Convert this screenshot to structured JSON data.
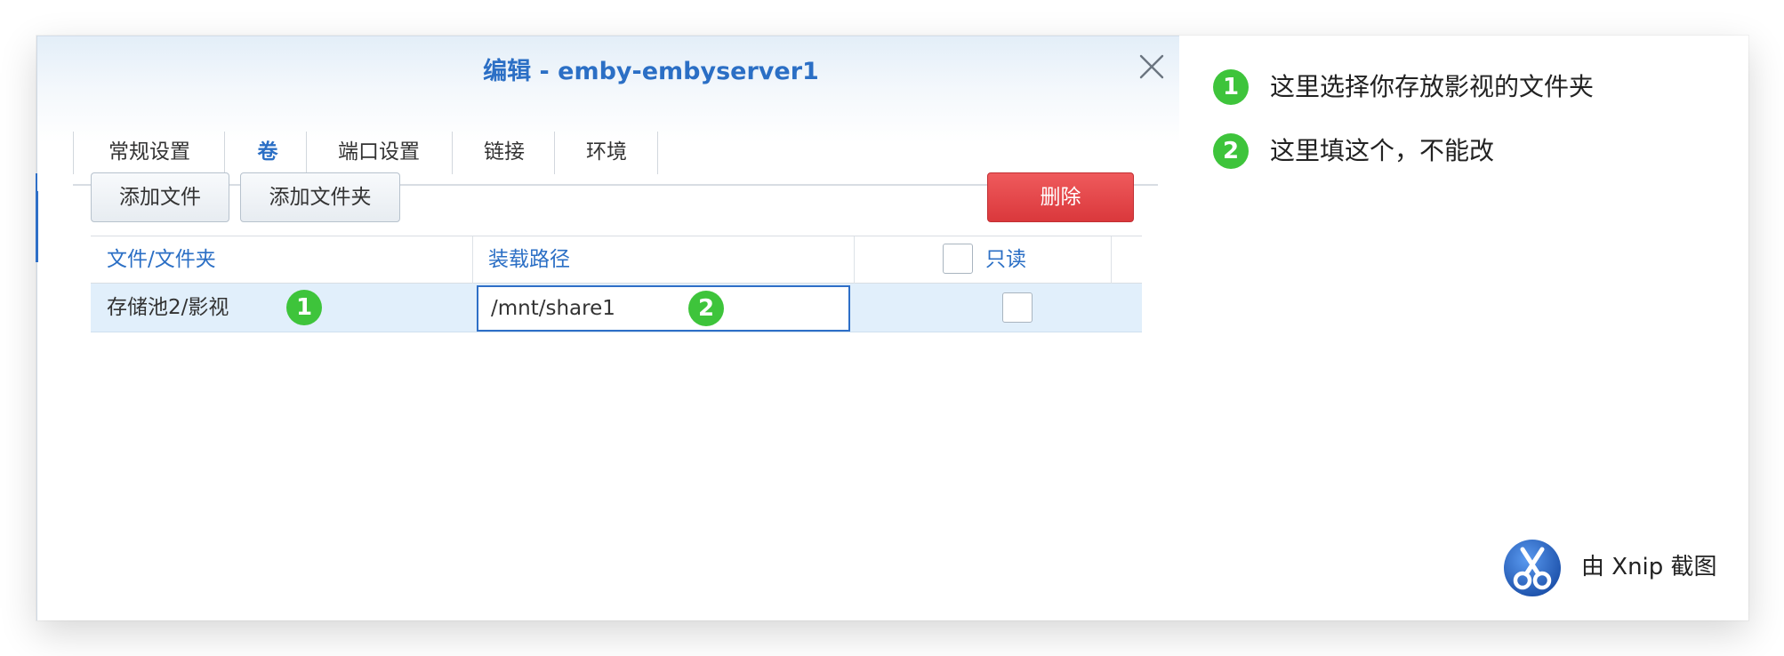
{
  "dialog": {
    "title": "编辑 - emby-embyserver1"
  },
  "tabs": [
    {
      "label": "常规设置"
    },
    {
      "label": "卷"
    },
    {
      "label": "端口设置"
    },
    {
      "label": "链接"
    },
    {
      "label": "环境"
    }
  ],
  "toolbar": {
    "add_file_label": "添加文件",
    "add_folder_label": "添加文件夹",
    "delete_label": "删除"
  },
  "table": {
    "headers": {
      "folder": "文件/文件夹",
      "mount_path": "装载路径",
      "readonly": "只读"
    },
    "rows": [
      {
        "folder": "存储池2/影视",
        "mount_path": "/mnt/share1",
        "readonly": false
      }
    ]
  },
  "markers": {
    "one": "1",
    "two": "2"
  },
  "notes": [
    {
      "number": "1",
      "text": "这里选择你存放影视的文件夹"
    },
    {
      "number": "2",
      "text": "这里填这个，不能改"
    }
  ],
  "watermark": {
    "text": "由 Xnip 截图"
  },
  "colors": {
    "accent": "#2b6fc5",
    "danger": "#e2474a",
    "marker": "#3ec43b",
    "row_selected": "#e1effb"
  }
}
